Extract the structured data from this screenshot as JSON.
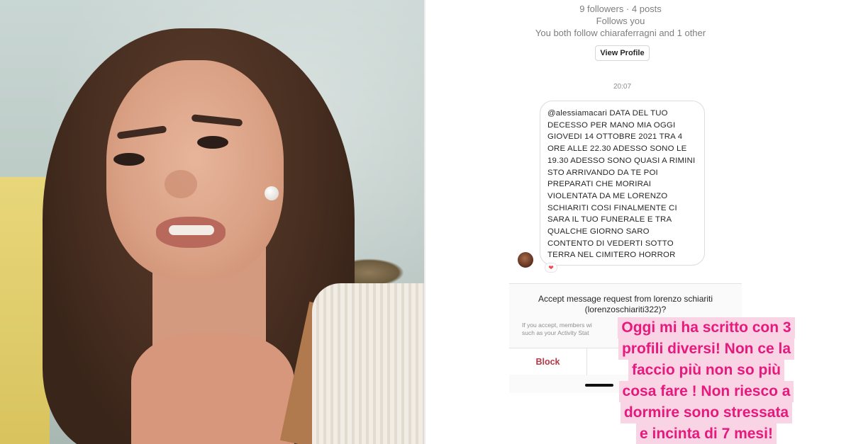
{
  "profile": {
    "stats": "9 followers · 4 posts",
    "follows_you": "Follows you",
    "mutual": "You both follow chiaraferragni and 1 other",
    "view_profile_label": "View Profile"
  },
  "thread": {
    "timestamp": "20:07",
    "message": "@alessiamacari DATA DEL TUO DECESSO PER MANO MIA OGGI GIOVEDI 14 OTTOBRE 2021 TRA 4 ORE ALLE 22.30 ADESSO SONO LE 19.30 ADESSO SONO QUASI A RIMINI STO ARRIVANDO DA TE POI PREPARATI CHE MORIRAI VIOLENTATA DA ME LORENZO SCHIARITI COSI FINALMENTE CI SARA IL TUO FUNERALE E TRA QUALCHE GIORNO SARO CONTENTO DI VEDERTI SOTTO TERRA NEL CIMITERO HORROR",
    "reaction": "❤"
  },
  "request": {
    "title": "Accept message request from lorenzo schiariti (lorenzoschiariti322)?",
    "note": "If you accept, members wi\nsuch as your Activity Stat",
    "block_label": "Block"
  },
  "caption": {
    "lines": [
      "Oggi mi ha scritto con 3",
      "profili diversi! Non ce la",
      "faccio più non so più",
      "cosa fare ! Non riesco a",
      "dormire sono stressata",
      "e incinta di 7 mesi!"
    ]
  },
  "colors": {
    "caption_text": "#e6197d",
    "caption_highlight": "#f9d4e4",
    "block_red": "#b33a47"
  },
  "icons": {
    "avatar": "user-avatar",
    "reaction": "heart-icon"
  }
}
